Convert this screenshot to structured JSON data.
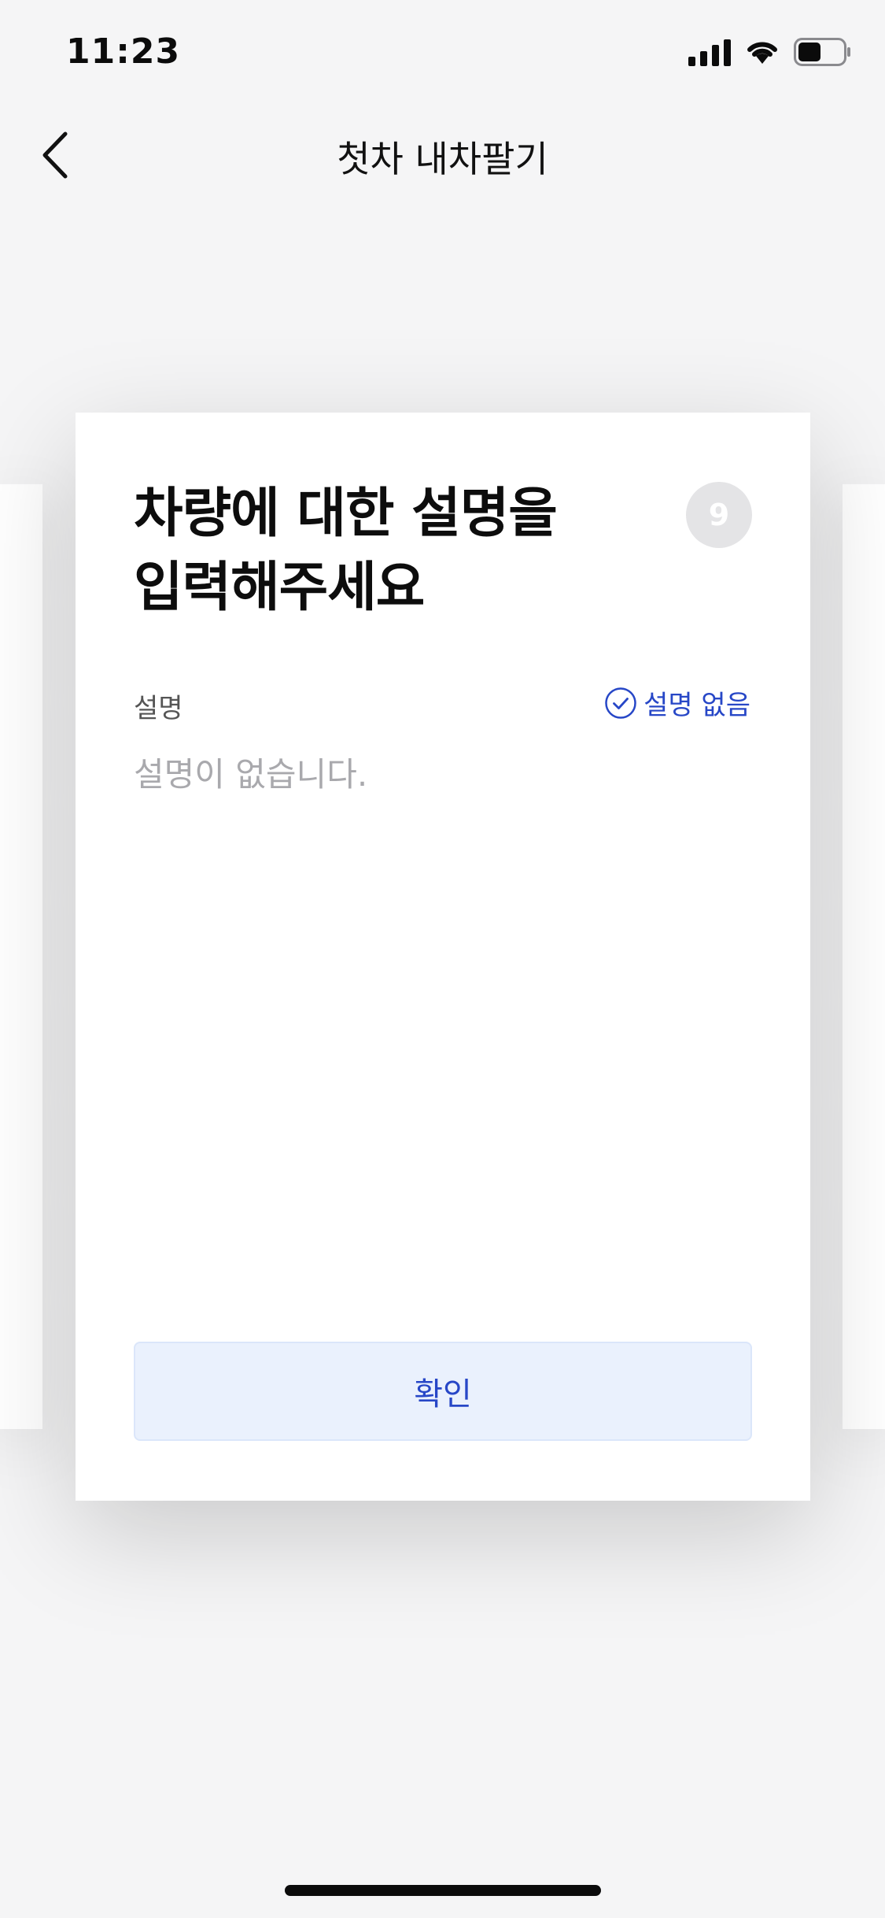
{
  "status_bar": {
    "time": "11:23",
    "icons": [
      "signal-icon",
      "wifi-icon",
      "battery-icon"
    ]
  },
  "nav": {
    "back_icon": "chevron-left-icon",
    "title": "첫차 내차팔기"
  },
  "card": {
    "title": "차량에 대한 설명을\n입력해주세요",
    "step_number": "9",
    "field_label": "설명",
    "no_description_label": "설명 없음",
    "no_description_icon": "check-circle-icon",
    "description_placeholder": "설명이 없습니다.",
    "description_value": "",
    "confirm_label": "확인"
  },
  "colors": {
    "accent": "#2747c7",
    "button_bg": "#eaf1fd",
    "badge_bg": "#e4e4e6",
    "placeholder": "#a9a9ad",
    "background": "#f5f5f6"
  }
}
